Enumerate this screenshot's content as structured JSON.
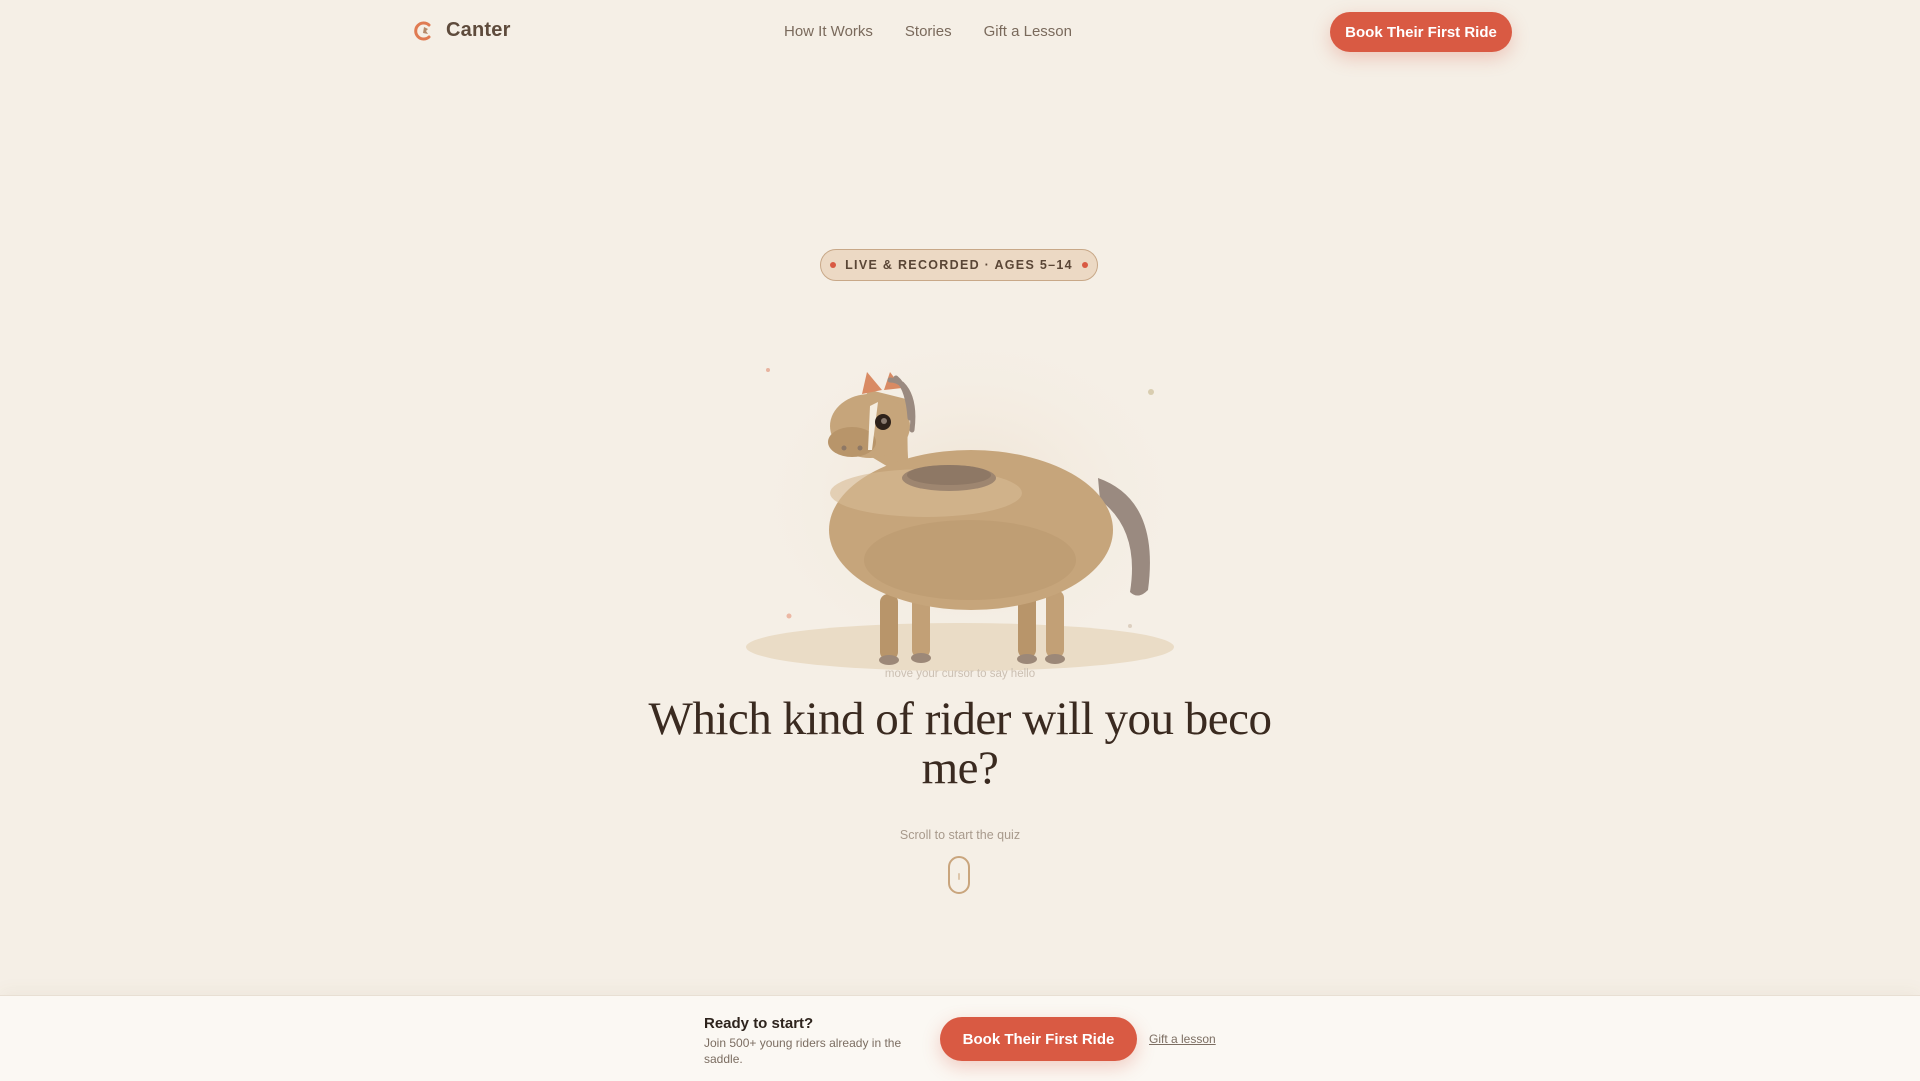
{
  "nav": {
    "brand": "Canter",
    "links": [
      "How It Works",
      "Stories",
      "Gift a Lesson"
    ],
    "cta": "Book Their First Ride"
  },
  "hero": {
    "badge": "LIVE & RECORDED · AGES 5–14",
    "hint": "move your cursor to say hello",
    "headline": "Which kind of rider will you become?",
    "scroll_prompt": "Scroll to start the quiz"
  },
  "sticky_bar": {
    "title": "Ready to start?",
    "subtitle": "Join 500+ young riders already in the saddle.",
    "cta": "Book Their First Ride",
    "secondary": "Gift a lesson"
  },
  "colors": {
    "background": "#f5efe6",
    "accent": "#d95a43",
    "horse_body": "#c6a57b",
    "text_dark": "#3a2a20"
  },
  "icons": [
    "canter-logo-icon",
    "horse-illustration",
    "scroll-mouse-icon"
  ]
}
